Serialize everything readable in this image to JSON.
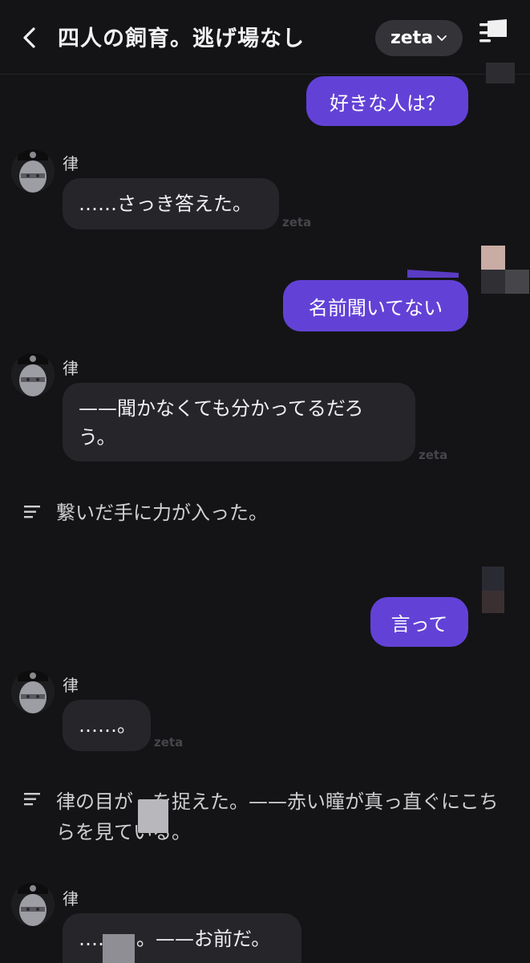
{
  "header": {
    "title": "四人の飼育。逃げ場なし",
    "badge_label": "zeta"
  },
  "watermark": "zeta",
  "messages": [
    {
      "role": "user",
      "text": "好きな人は？"
    },
    {
      "role": "character",
      "name": "律",
      "text": "……さっき答えた。"
    },
    {
      "role": "user",
      "text": "名前聞いてない"
    },
    {
      "role": "character",
      "name": "律",
      "text": "——聞かなくても分かってるだろう。"
    },
    {
      "role": "narration",
      "text": "繋いだ手に力が入った。"
    },
    {
      "role": "user",
      "text": "言って"
    },
    {
      "role": "character",
      "name": "律",
      "text": "……。"
    },
    {
      "role": "narration",
      "text": "律の目が　を捉えた。——赤い瞳が真っ直ぐにこちらを見ている。"
    },
    {
      "role": "character",
      "name": "律",
      "text": "……　。——お前だ。"
    }
  ],
  "colors": {
    "background": "#141416",
    "user_bubble": "#6242d6",
    "character_bubble": "#26262a"
  }
}
